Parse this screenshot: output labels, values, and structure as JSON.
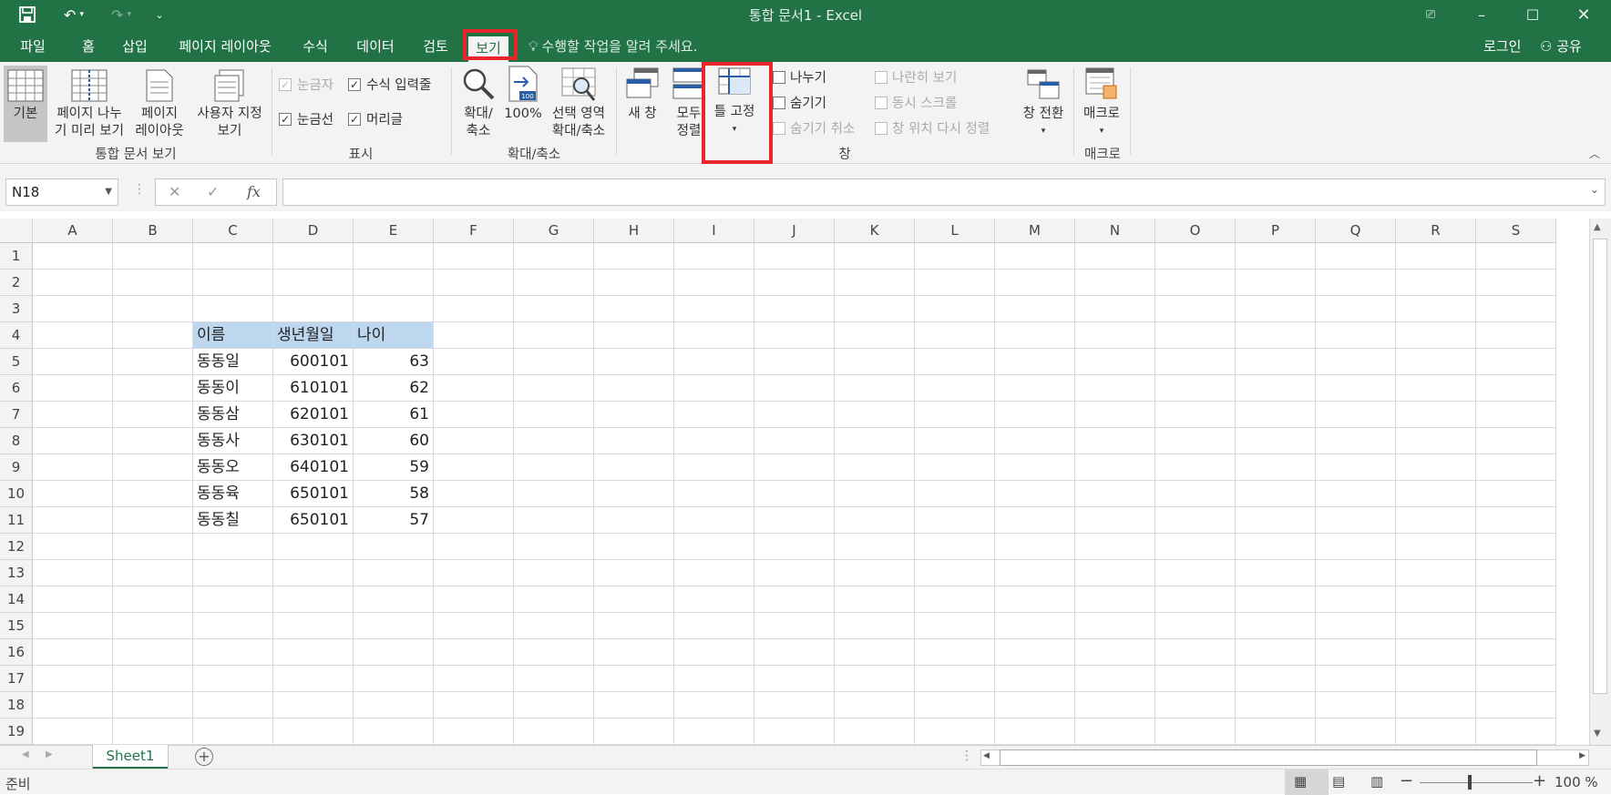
{
  "window": {
    "title": "통합 문서1 - Excel"
  },
  "tabs": [
    {
      "label": "파일"
    },
    {
      "label": "홈"
    },
    {
      "label": "삽입"
    },
    {
      "label": "페이지 레이아웃"
    },
    {
      "label": "수식"
    },
    {
      "label": "데이터"
    },
    {
      "label": "검토"
    },
    {
      "label": "보기"
    }
  ],
  "tell_me": "수행할 작업을 알려 주세요.",
  "account": {
    "login": "로그인",
    "share": "공유"
  },
  "ribbon": {
    "views": {
      "normal": "기본",
      "page_break_1": "페이지 나누",
      "page_break_2": "기 미리 보기",
      "page_layout_1": "페이지",
      "page_layout_2": "레이아웃",
      "custom_1": "사용자 지정",
      "custom_2": "보기",
      "group": "통합 문서 보기"
    },
    "show": {
      "ruler": "눈금자",
      "formula_bar": "수식 입력줄",
      "gridlines": "눈금선",
      "headings": "머리글",
      "group": "표시"
    },
    "zoom": {
      "zoom_1": "확대/",
      "zoom_2": "축소",
      "hundred": "100%",
      "selection_1": "선택 영역",
      "selection_2": "확대/축소",
      "group": "확대/축소"
    },
    "window": {
      "new_window": "새 창",
      "arrange_1": "모두",
      "arrange_2": "정렬",
      "freeze": "틀 고정",
      "split": "나누기",
      "hide": "숨기기",
      "unhide": "숨기기 취소",
      "side_by_side": "나란히 보기",
      "sync_scroll": "동시 스크롤",
      "reset_position": "창 위치 다시 정렬",
      "switch": "창 전환",
      "group": "창"
    },
    "macros": {
      "label": "매크로",
      "group": "매크로"
    }
  },
  "name_box": "N18",
  "columns": [
    "A",
    "B",
    "C",
    "D",
    "E",
    "F",
    "G",
    "H",
    "I",
    "J",
    "K",
    "L",
    "M",
    "N",
    "O",
    "P",
    "Q",
    "R",
    "S"
  ],
  "rows": [
    "1",
    "2",
    "3",
    "4",
    "5",
    "6",
    "7",
    "8",
    "9",
    "10",
    "11",
    "12",
    "13",
    "14",
    "15",
    "16",
    "17",
    "18",
    "19"
  ],
  "table": {
    "headers": [
      "이름",
      "생년월일",
      "나이"
    ],
    "rows": [
      [
        "동동일",
        "600101",
        "63"
      ],
      [
        "동동이",
        "610101",
        "62"
      ],
      [
        "동동삼",
        "620101",
        "61"
      ],
      [
        "동동사",
        "630101",
        "60"
      ],
      [
        "동동오",
        "640101",
        "59"
      ],
      [
        "동동육",
        "650101",
        "58"
      ],
      [
        "동동칠",
        "650101",
        "57"
      ]
    ]
  },
  "sheets": [
    "Sheet1"
  ],
  "status": {
    "ready": "준비",
    "zoom": "100 %"
  },
  "colors": {
    "excel_green": "#217346",
    "highlight_red": "#e8242c",
    "table_header": "#bdd7ee"
  }
}
